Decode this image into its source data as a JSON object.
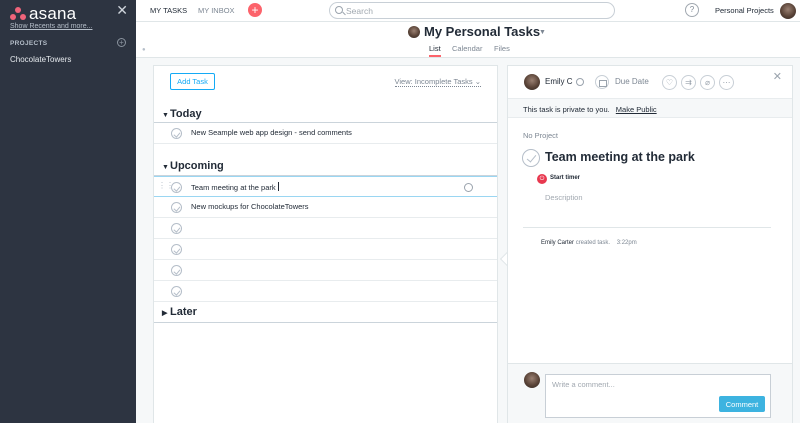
{
  "sidebar": {
    "logo_text": "asana",
    "show_recents": "Show Recents and more...",
    "projects_header": "PROJECTS",
    "projects": [
      "ChocolateTowers"
    ]
  },
  "topbar": {
    "tab_my_tasks": "MY TASKS",
    "tab_inbox": "MY INBOX",
    "search_placeholder": "Search",
    "help_label": "?",
    "workspace": "Personal Projects"
  },
  "header": {
    "title": "My Personal Tasks",
    "tabs": [
      "List",
      "Calendar",
      "Files"
    ],
    "active_tab": "List"
  },
  "list": {
    "add_task_label": "Add Task",
    "view_filter": "View: Incomplete Tasks",
    "sections": [
      {
        "name": "Today",
        "tasks": [
          "New Seample web app design - send comments"
        ]
      },
      {
        "name": "Upcoming",
        "tasks": [
          "Team meeting at the park",
          "New mockups for ChocolateTowers",
          "",
          "",
          "",
          ""
        ]
      },
      {
        "name": "Later",
        "tasks": []
      }
    ],
    "selected_task": "Team meeting at the park"
  },
  "detail": {
    "assignee": "Emily C",
    "due_date_label": "Due Date",
    "privacy_text": "This task is private to you.",
    "make_public": "Make Public",
    "project": "No Project",
    "title": "Team meeting at the park",
    "start_timer": "Start timer",
    "description_placeholder": "Description",
    "activity_user": "Emily Carter",
    "activity_text": "created task.",
    "activity_time": "3:22pm",
    "comment_placeholder": "Write a comment...",
    "comment_button": "Comment"
  },
  "colors": {
    "sidebar_bg": "#2d3441",
    "accent_blue": "#14aaf5",
    "accent_coral": "#fc636b",
    "timer_red": "#e8384f"
  }
}
